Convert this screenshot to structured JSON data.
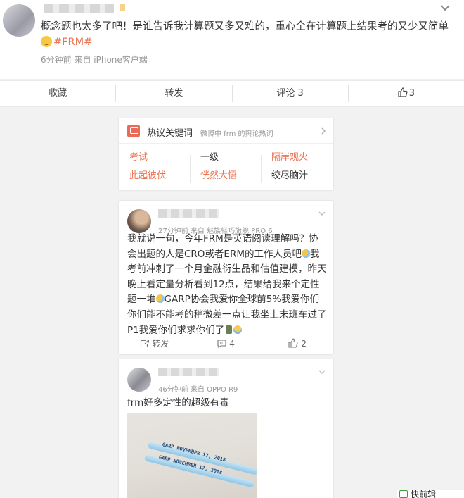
{
  "post": {
    "text": "概念题也太多了吧！是谁告诉我计算题又多又难的，重心全在计算题上结果考的又少又简单",
    "hashtag": "#FRM#",
    "time": "6分钟前",
    "source": "来自 iPhone客户端"
  },
  "actions": {
    "collect": "收藏",
    "repost": "转发",
    "comment": "评论 3",
    "like": "3"
  },
  "hot_keywords": {
    "title": "热议关键词",
    "subtitle": "微博中 frm 的舆论热词",
    "rows": [
      [
        "考试",
        "一级",
        "隔岸观火"
      ],
      [
        "此起彼伏",
        "恍然大悟",
        "绞尽脑汁"
      ]
    ],
    "highlight_color": "#eb7350"
  },
  "comments": [
    {
      "time": "27分钟前",
      "source": "来自 魅族轻巧旗舰 PRO 6",
      "text": "我就说一句，今年FRM是英语阅读理解吗？协会出题的人是CRO或者ERM的工作人员吧",
      "text2": "我考前冲刺了一个月金融衍生品和估值建模，昨天晚上看定量分析看到12点，结果给我来个定性题一堆",
      "text3": "GARP协会我爱你全球前5%我爱你们你们能不能考的稍微差一点让我坐上末班车过了P1我爱你们求求你们了",
      "repost": "转发",
      "comment_count": "4",
      "like_count": "2"
    },
    {
      "time": "46分钟前",
      "source": "来自 OPPO R9",
      "text": "frm好多定性的超级有毒",
      "photo_pen_text": "GARP NOVEMBER 17, 2018"
    }
  ],
  "quick_reply": "快前辑"
}
